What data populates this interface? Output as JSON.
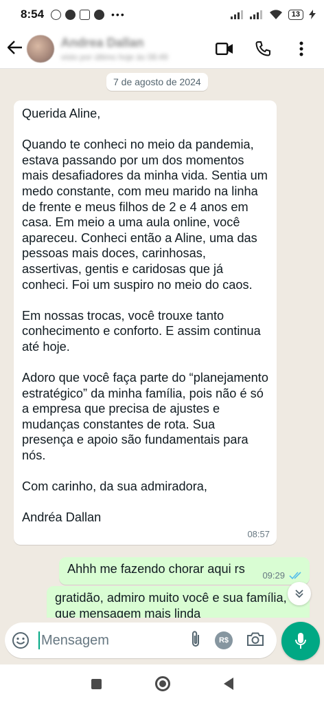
{
  "status_bar": {
    "time": "8:54",
    "battery": "13"
  },
  "header": {
    "contact_name": "Andrea Dallan",
    "contact_status": "visto por último hoje às 08:49"
  },
  "chat": {
    "date_chip": "7 de agosto de 2024",
    "incoming": {
      "text": "Querida Aline,\n\nQuando te conheci no meio da pandemia, estava passando por um dos momentos mais desafiadores da minha vida. Sentia um medo constante, com meu marido na linha de frente e meus filhos de 2 e 4 anos em casa. Em meio a uma aula online, você apareceu. Conheci então a Aline, uma das pessoas mais doces, carinhosas, assertivas, gentis e caridosas que já conheci.  Foi um suspiro no meio do caos.\n\nEm nossas trocas, você trouxe tanto conhecimento e conforto. E assim continua até hoje.\n\nAdoro que você faça parte do “planejamento estratégico” da minha família, pois não é só a empresa que precisa de ajustes e mudanças constantes de rota. Sua presença e apoio são fundamentais para nós.\n\nCom carinho, da sua admiradora,\n\nAndréa Dallan",
      "time": "08:57"
    },
    "outgoing": [
      {
        "text": "Ahhh me fazendo chorar aqui rs",
        "time": "09:29"
      },
      {
        "text": "gratidão, admiro muito você e sua família, que mensagem mais linda"
      }
    ]
  },
  "input": {
    "placeholder": "Mensagem",
    "currency_label": "R$"
  },
  "colors": {
    "accent": "#00a884",
    "outgoing_bubble": "#d9fdd3",
    "chat_bg": "#efeae2",
    "read_ticks": "#53bdeb"
  }
}
